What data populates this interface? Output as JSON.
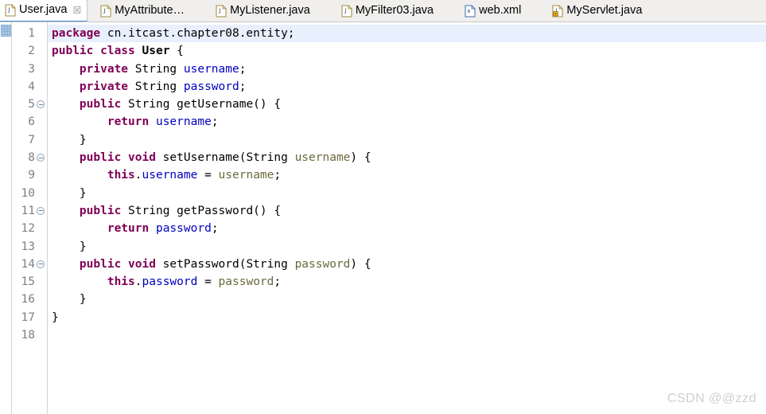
{
  "editor": {
    "tabs": [
      {
        "label": "User.java",
        "icon": "java-file-icon",
        "active": true,
        "closable": true,
        "close_glyph": "☒"
      },
      {
        "label": "MyAttribute…",
        "icon": "java-file-icon",
        "active": false,
        "closable": false,
        "close_glyph": ""
      },
      {
        "label": "MyListener.java",
        "icon": "java-file-icon",
        "active": false,
        "closable": false,
        "close_glyph": ""
      },
      {
        "label": "MyFilter03.java",
        "icon": "java-file-icon",
        "active": false,
        "closable": false,
        "close_glyph": ""
      },
      {
        "label": "web.xml",
        "icon": "xml-file-icon",
        "active": false,
        "closable": false,
        "close_glyph": ""
      },
      {
        "label": "MyServlet.java",
        "icon": "java-locked-file-icon",
        "active": false,
        "closable": false,
        "close_glyph": ""
      }
    ],
    "gutter": {
      "line_numbers": [
        "1",
        "2",
        "3",
        "4",
        "5",
        "6",
        "7",
        "8",
        "9",
        "10",
        "11",
        "12",
        "13",
        "14",
        "15",
        "16",
        "17",
        "18"
      ],
      "fold_marker_lines": [
        5,
        8,
        11,
        14
      ],
      "annotation_marker_line": 1
    },
    "code": {
      "highlighted_line": 1,
      "lines": [
        {
          "n": "1",
          "tokens": [
            {
              "t": "package",
              "c": "kw"
            },
            {
              "t": " cn.itcast.chapter08.entity;",
              "c": "pln"
            }
          ]
        },
        {
          "n": "2",
          "tokens": [
            {
              "t": "public class",
              "c": "kw"
            },
            {
              "t": " ",
              "c": "pln"
            },
            {
              "t": "User",
              "c": "cls"
            },
            {
              "t": " {",
              "c": "pln"
            }
          ]
        },
        {
          "n": "3",
          "tokens": [
            {
              "t": "    ",
              "c": "pln"
            },
            {
              "t": "private",
              "c": "kw"
            },
            {
              "t": " String ",
              "c": "pln"
            },
            {
              "t": "username",
              "c": "fld"
            },
            {
              "t": ";",
              "c": "pln"
            }
          ]
        },
        {
          "n": "4",
          "tokens": [
            {
              "t": "    ",
              "c": "pln"
            },
            {
              "t": "private",
              "c": "kw"
            },
            {
              "t": " String ",
              "c": "pln"
            },
            {
              "t": "password",
              "c": "fld"
            },
            {
              "t": ";",
              "c": "pln"
            }
          ]
        },
        {
          "n": "5",
          "tokens": [
            {
              "t": "    ",
              "c": "pln"
            },
            {
              "t": "public",
              "c": "kw"
            },
            {
              "t": " String getUsername() {",
              "c": "pln"
            }
          ]
        },
        {
          "n": "6",
          "tokens": [
            {
              "t": "        ",
              "c": "pln"
            },
            {
              "t": "return",
              "c": "kw"
            },
            {
              "t": " ",
              "c": "pln"
            },
            {
              "t": "username",
              "c": "fld"
            },
            {
              "t": ";",
              "c": "pln"
            }
          ]
        },
        {
          "n": "7",
          "tokens": [
            {
              "t": "    }",
              "c": "pln"
            }
          ]
        },
        {
          "n": "8",
          "tokens": [
            {
              "t": "    ",
              "c": "pln"
            },
            {
              "t": "public void",
              "c": "kw"
            },
            {
              "t": " setUsername(String ",
              "c": "pln"
            },
            {
              "t": "username",
              "c": "par"
            },
            {
              "t": ") {",
              "c": "pln"
            }
          ]
        },
        {
          "n": "9",
          "tokens": [
            {
              "t": "        ",
              "c": "pln"
            },
            {
              "t": "this",
              "c": "kw"
            },
            {
              "t": ".",
              "c": "pln"
            },
            {
              "t": "username",
              "c": "fld"
            },
            {
              "t": " = ",
              "c": "pln"
            },
            {
              "t": "username",
              "c": "par"
            },
            {
              "t": ";",
              "c": "pln"
            }
          ]
        },
        {
          "n": "10",
          "tokens": [
            {
              "t": "    }",
              "c": "pln"
            }
          ]
        },
        {
          "n": "11",
          "tokens": [
            {
              "t": "    ",
              "c": "pln"
            },
            {
              "t": "public",
              "c": "kw"
            },
            {
              "t": " String getPassword() {",
              "c": "pln"
            }
          ]
        },
        {
          "n": "12",
          "tokens": [
            {
              "t": "        ",
              "c": "pln"
            },
            {
              "t": "return",
              "c": "kw"
            },
            {
              "t": " ",
              "c": "pln"
            },
            {
              "t": "password",
              "c": "fld"
            },
            {
              "t": ";",
              "c": "pln"
            }
          ]
        },
        {
          "n": "13",
          "tokens": [
            {
              "t": "    }",
              "c": "pln"
            }
          ]
        },
        {
          "n": "14",
          "tokens": [
            {
              "t": "    ",
              "c": "pln"
            },
            {
              "t": "public void",
              "c": "kw"
            },
            {
              "t": " setPassword(String ",
              "c": "pln"
            },
            {
              "t": "password",
              "c": "par"
            },
            {
              "t": ") {",
              "c": "pln"
            }
          ]
        },
        {
          "n": "15",
          "tokens": [
            {
              "t": "        ",
              "c": "pln"
            },
            {
              "t": "this",
              "c": "kw"
            },
            {
              "t": ".",
              "c": "pln"
            },
            {
              "t": "password",
              "c": "fld"
            },
            {
              "t": " = ",
              "c": "pln"
            },
            {
              "t": "password",
              "c": "par"
            },
            {
              "t": ";",
              "c": "pln"
            }
          ]
        },
        {
          "n": "16",
          "tokens": [
            {
              "t": "    }",
              "c": "pln"
            }
          ]
        },
        {
          "n": "17",
          "tokens": [
            {
              "t": "}",
              "c": "pln"
            }
          ]
        },
        {
          "n": "18",
          "tokens": [
            {
              "t": "",
              "c": "pln"
            }
          ]
        }
      ]
    },
    "watermark": "CSDN @@zzd",
    "colors": {
      "keyword": "#7f0055",
      "field": "#0000c0",
      "parameter": "#6a6a3c",
      "plain": "#000000",
      "line_number": "#808080",
      "highlight_line_bg": "#e8f0fe",
      "tab_bar_bg": "#f0efee",
      "active_tab_underline": "#4a90d9",
      "watermark": "#cfcfcf"
    }
  }
}
